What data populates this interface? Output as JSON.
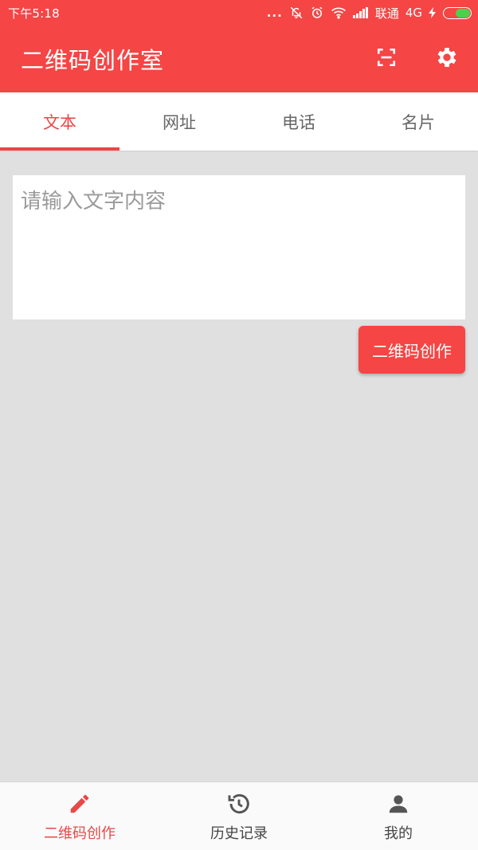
{
  "status_bar": {
    "time": "下午5:18",
    "dots": "...",
    "carrier": "联通",
    "network": "4G"
  },
  "app_bar": {
    "title": "二维码创作室"
  },
  "tabs": [
    {
      "label": "文本",
      "active": true
    },
    {
      "label": "网址",
      "active": false
    },
    {
      "label": "电话",
      "active": false
    },
    {
      "label": "名片",
      "active": false
    }
  ],
  "main": {
    "input_placeholder": "请输入文字内容",
    "input_value": "",
    "create_button_label": "二维码创作"
  },
  "bottom_nav": [
    {
      "label": "二维码创作",
      "icon": "pencil-icon",
      "active": true
    },
    {
      "label": "历史记录",
      "icon": "history-icon",
      "active": false
    },
    {
      "label": "我的",
      "icon": "person-icon",
      "active": false
    }
  ],
  "colors": {
    "primary": "#f54545",
    "accent_text": "#e84848",
    "background": "#e0e0e0",
    "battery": "#4cd04c"
  }
}
